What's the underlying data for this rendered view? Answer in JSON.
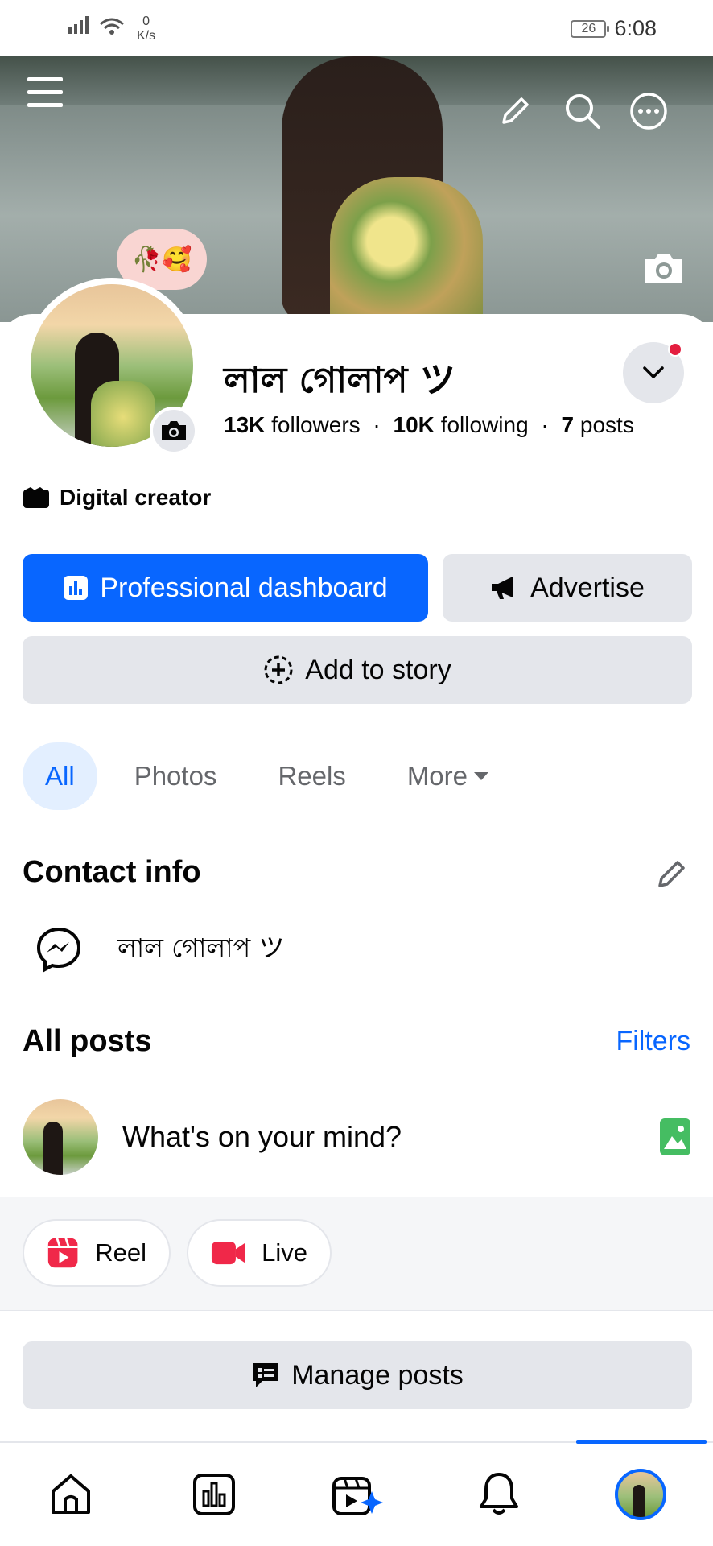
{
  "status_bar": {
    "net_speed_value": "0",
    "net_speed_unit": "K/s",
    "battery": "26",
    "time": "6:08"
  },
  "profile": {
    "name": "লাল গোলাপ ツ",
    "stats": {
      "followers_count": "13K",
      "followers_label": "followers",
      "following_count": "10K",
      "following_label": "following",
      "posts_count": "7",
      "posts_label": "posts",
      "separator": "·"
    },
    "bubble_emoji": "🥀🥰",
    "category": "Digital creator"
  },
  "actions": {
    "professional_dashboard": "Professional dashboard",
    "advertise": "Advertise",
    "add_to_story": "Add to story",
    "manage_posts": "Manage posts"
  },
  "tabs": {
    "all": "All",
    "photos": "Photos",
    "reels": "Reels",
    "more": "More"
  },
  "contact": {
    "title": "Contact info",
    "messenger_name": "লাল গোলাপ ツ"
  },
  "posts": {
    "title": "All posts",
    "filters": "Filters",
    "composer_placeholder": "What's on your mind?",
    "reel_label": "Reel",
    "live_label": "Live"
  },
  "icons": {
    "menu": "hamburger-menu-icon",
    "edit": "pencil-icon",
    "search": "search-icon",
    "more": "more-options-icon",
    "camera": "camera-icon",
    "home": "home-icon",
    "dashboard": "bar-chart-icon",
    "video": "video-clapper-icon",
    "notifications": "bell-icon"
  },
  "colors": {
    "accent": "#0866ff",
    "secondary_button": "#e4e6eb",
    "reel_red": "#f02849",
    "photo_green": "#45bd62",
    "badge_red": "#e41e3f"
  }
}
